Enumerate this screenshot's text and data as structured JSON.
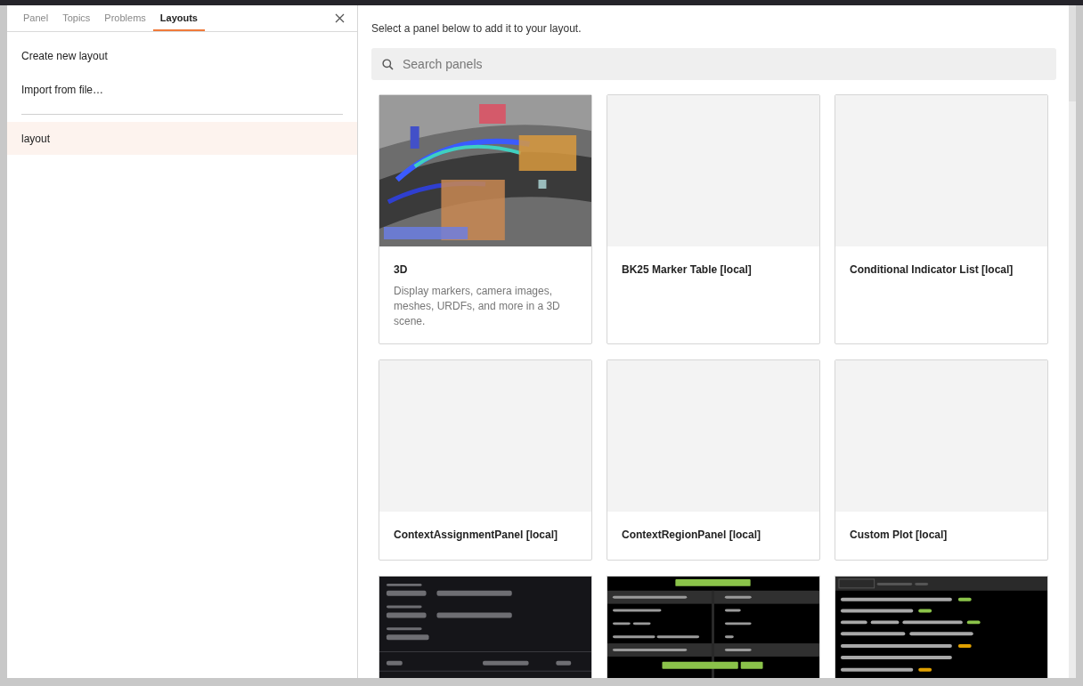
{
  "sidebar": {
    "tabs": [
      {
        "label": "Panel",
        "selected": false
      },
      {
        "label": "Topics",
        "selected": false
      },
      {
        "label": "Problems",
        "selected": false
      },
      {
        "label": "Layouts",
        "selected": true
      }
    ],
    "actions": [
      "Create new layout",
      "Import from file…"
    ],
    "layouts": [
      {
        "label": "layout",
        "selected": true
      }
    ]
  },
  "main": {
    "hint": "Select a panel below to add it to your layout.",
    "search": {
      "placeholder": "Search panels"
    },
    "panels": [
      {
        "kind": "picture",
        "title": "3D",
        "description": "Display markers, camera images, meshes, URDFs, and more in a 3D scene."
      },
      {
        "kind": "blank",
        "title": "BK25 Marker Table [local]"
      },
      {
        "kind": "blank",
        "title": "Conditional Indicator List [local]"
      },
      {
        "kind": "blank",
        "title": "ContextAssignmentPanel [local]"
      },
      {
        "kind": "blank",
        "title": "ContextRegionPanel [local]"
      },
      {
        "kind": "blank",
        "title": "Custom Plot [local]"
      },
      {
        "kind": "tree"
      },
      {
        "kind": "table"
      },
      {
        "kind": "log"
      }
    ]
  }
}
